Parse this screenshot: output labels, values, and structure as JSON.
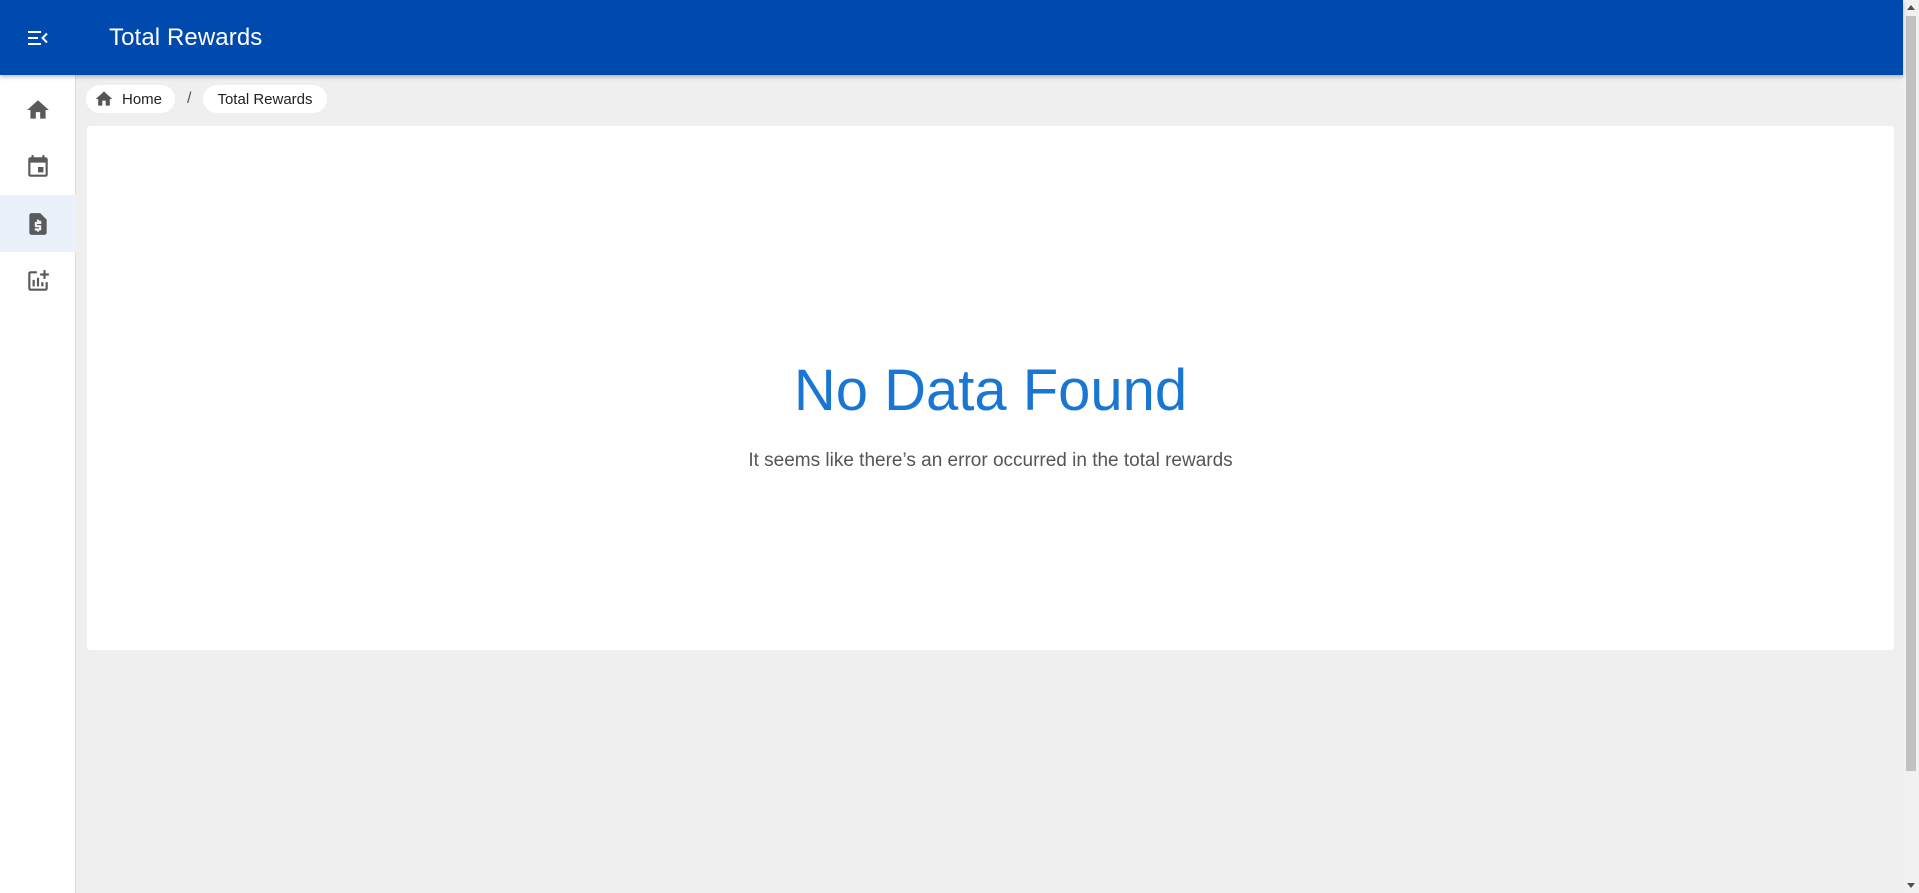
{
  "header": {
    "title": "Total Rewards",
    "menu_icon": "menu-collapse-icon",
    "background": "#0049af"
  },
  "sidebar": {
    "items": [
      {
        "icon": "home-icon",
        "active": false
      },
      {
        "icon": "calendar-icon",
        "active": false
      },
      {
        "icon": "invoice-dollar-icon",
        "active": true
      },
      {
        "icon": "chart-add-icon",
        "active": false
      }
    ]
  },
  "breadcrumb": {
    "home_label": "Home",
    "separator": "/",
    "current_label": "Total Rewards"
  },
  "empty_state": {
    "title": "No Data Found",
    "message": "It seems like there’s an error occurred in the total rewards",
    "title_color": "#1976d2"
  }
}
